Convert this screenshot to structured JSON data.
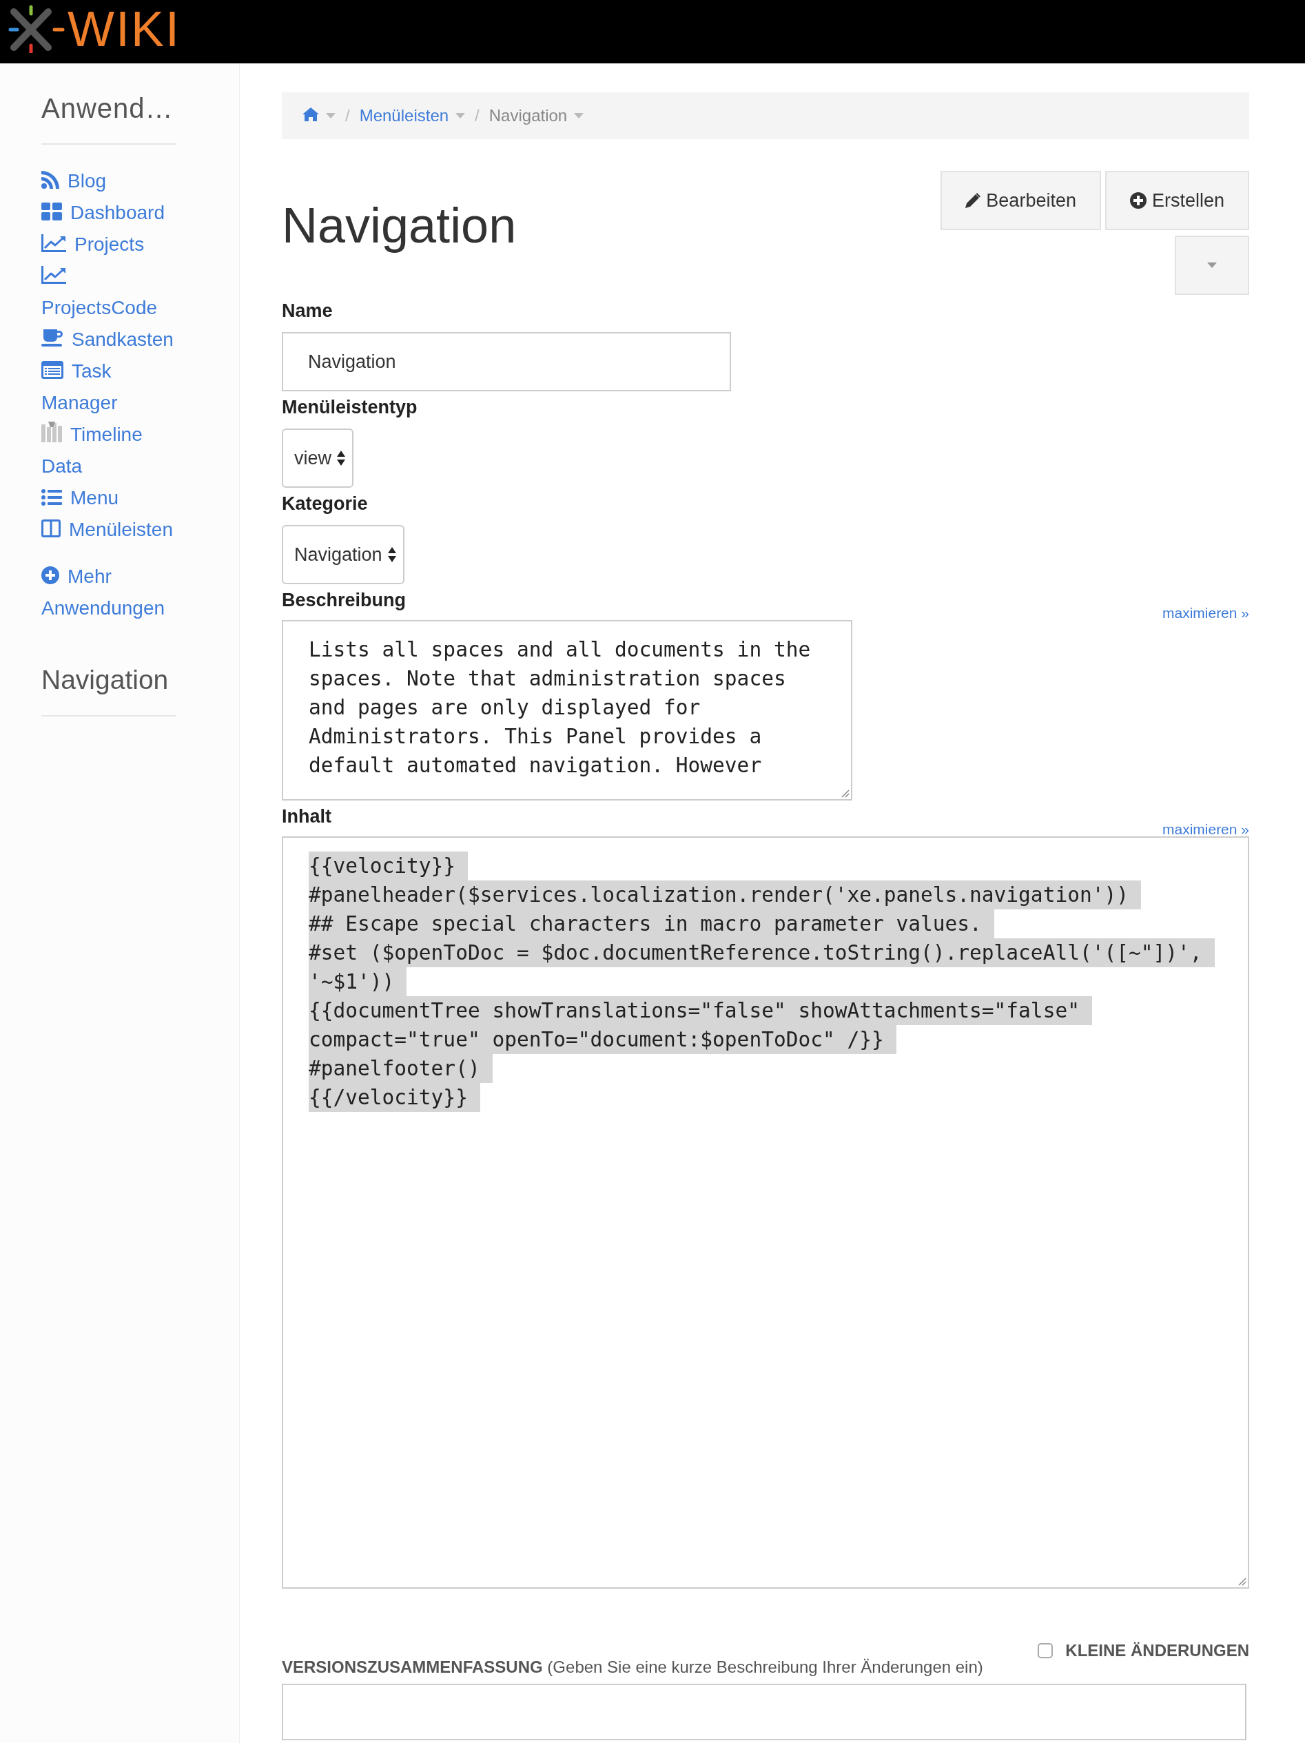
{
  "header": {
    "logo_text": "WIKI"
  },
  "sidebar": {
    "title": "Anwend…",
    "items": [
      {
        "kind": "rss",
        "label": "Blog"
      },
      {
        "kind": "grid",
        "label": "Dashboard"
      },
      {
        "kind": "chart",
        "label": "Projects"
      },
      {
        "kind": "chart",
        "label": "ProjectsCode"
      },
      {
        "kind": "cup",
        "label": "Sandkasten"
      },
      {
        "kind": "card",
        "label": "Task Manager"
      },
      {
        "kind": "bars",
        "label": "Timeline Data"
      },
      {
        "kind": "list",
        "label": "Menu"
      },
      {
        "kind": "columns",
        "label": "Menüleisten"
      }
    ],
    "more": {
      "kind": "plus",
      "label": "Mehr Anwendungen"
    },
    "panel_title": "Navigation"
  },
  "breadcrumb": [
    {
      "kind": "home",
      "current": false
    },
    {
      "kind": "page",
      "separator": "/",
      "label": "Menüleisten",
      "current": false
    },
    {
      "kind": "page",
      "separator": "/",
      "label": "Navigation",
      "current": true
    }
  ],
  "title": "Navigation",
  "actions": [
    {
      "kind": "edit",
      "label": "Bearbeiten"
    },
    {
      "kind": "create",
      "label": "Erstellen"
    }
  ],
  "fields": [
    {
      "kind": "text",
      "label": "Name",
      "value": "Navigation"
    },
    {
      "kind": "select",
      "label": "Menüleistentyp",
      "value": "view"
    },
    {
      "kind": "select",
      "label": "Kategorie",
      "value": "Navigation"
    },
    {
      "kind": "textarea",
      "label": "Beschreibung",
      "link": "maximieren »",
      "value": "Lists all spaces and all documents in the spaces. Note that administration spaces and pages are only displayed for Administrators. This Panel provides a default automated navigation. However"
    },
    {
      "kind": "code",
      "label": "Inhalt",
      "link": "maximieren »",
      "lines": [
        "{{velocity}}",
        "#panelheader($services.localization.render('xe.panels.navigation'))",
        "## Escape special characters in macro parameter values.",
        "#set ($openToDoc = $doc.documentReference.toString().replaceAll('([~\"])',",
        "'~$1'))",
        "{{documentTree showTranslations=\"false\" showAttachments=\"false\"",
        "compact=\"true\" openTo=\"document:$openToDoc\" /}}",
        "#panelfooter()",
        "{{/velocity}}"
      ]
    }
  ],
  "version_summary": {
    "label": "**VERSIONSZUSAMMENFASSUNG** (Geben Sie eine kurze Beschreibung Ihrer Änderungen ein)"
  },
  "minor_edit": {
    "label": "KLEINE ÄNDERUNGEN",
    "checked": false
  }
}
